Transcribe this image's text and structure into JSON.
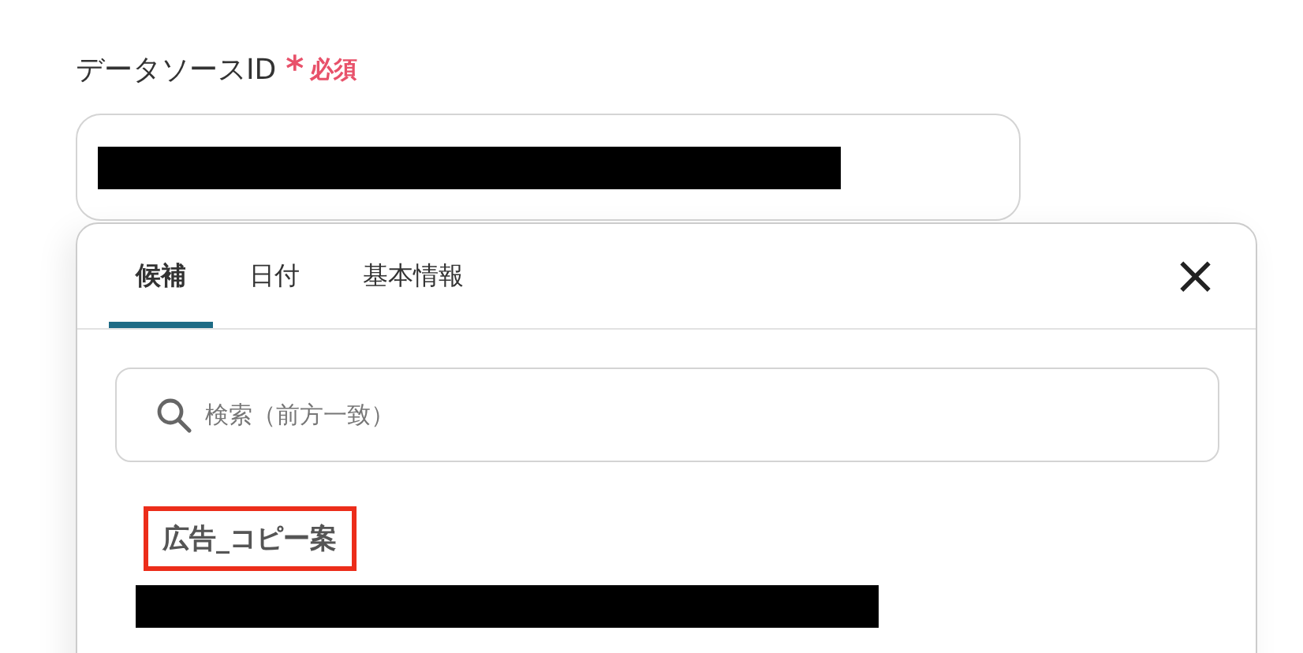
{
  "field": {
    "label": "データソースID",
    "required_mark": "*",
    "required_text": "必須",
    "value_redacted": true
  },
  "dropdown": {
    "tabs": [
      {
        "label": "候補",
        "selected": true
      },
      {
        "label": "日付",
        "selected": false
      },
      {
        "label": "基本情報",
        "selected": false
      }
    ],
    "close": "×",
    "search": {
      "placeholder": "検索（前方一致）"
    },
    "items": [
      {
        "title": "広告_コピー案",
        "highlighted": true,
        "id_redacted": true
      }
    ]
  }
}
